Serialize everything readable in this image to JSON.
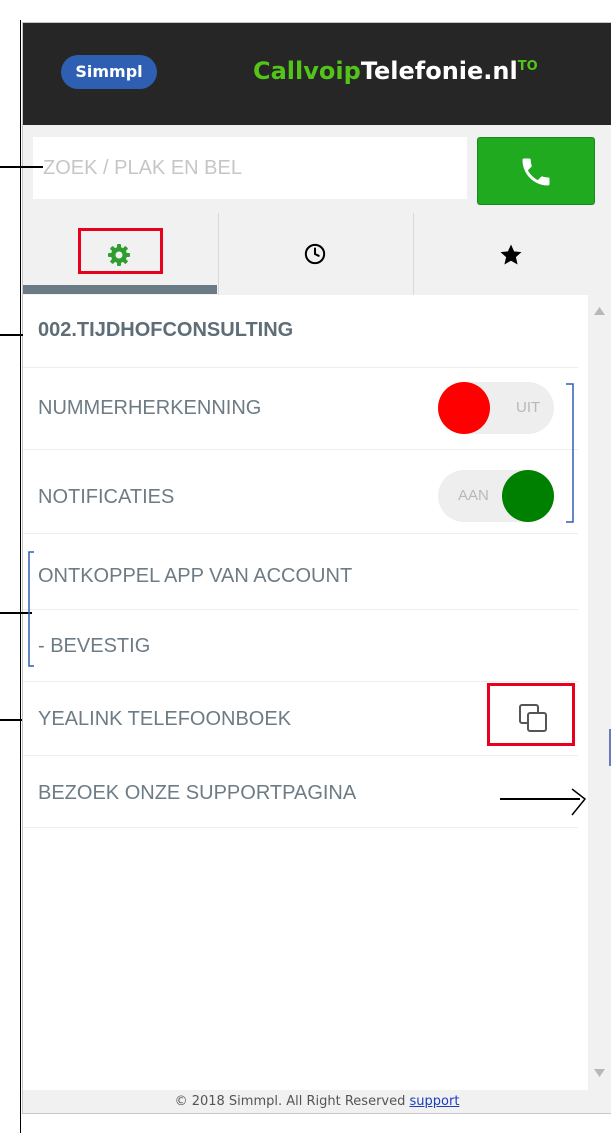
{
  "header": {
    "logo_text": "Simmpl",
    "brand_part1": "Callvoip",
    "brand_part2": "Telefonie.nl",
    "brand_superscript": "TO"
  },
  "search": {
    "placeholder": "ZOEK / PLAK EN BEL",
    "value": ""
  },
  "tabs": [
    {
      "icon": "gear-icon",
      "active": true
    },
    {
      "icon": "clock-icon",
      "active": false
    },
    {
      "icon": "star-icon",
      "active": false
    }
  ],
  "settings": {
    "account": "002.TIJDHOFCONSULTING",
    "caller_id": {
      "label": "NUMMERHERKENNING",
      "state_text": "UIT",
      "on": false,
      "knob_color": "#ff0000"
    },
    "notifications": {
      "label": "NOTIFICATIES",
      "state_text": "AAN",
      "on": true,
      "knob_color": "#008000"
    },
    "disconnect": "ONTKOPPEL APP VAN ACCOUNT",
    "confirm": "- BEVESTIG",
    "phonebook": "YEALINK TELEFOONBOEK",
    "support_page": "BEZOEK ONZE SUPPORTPAGINA"
  },
  "footer": {
    "text": "© 2018 Simmpl. All Right Reserved",
    "link": "support"
  },
  "colors": {
    "call_button": "#1faa1f",
    "highlight": "#e8001c",
    "bracket": "#2f5fb3",
    "topbar": "#262626"
  }
}
